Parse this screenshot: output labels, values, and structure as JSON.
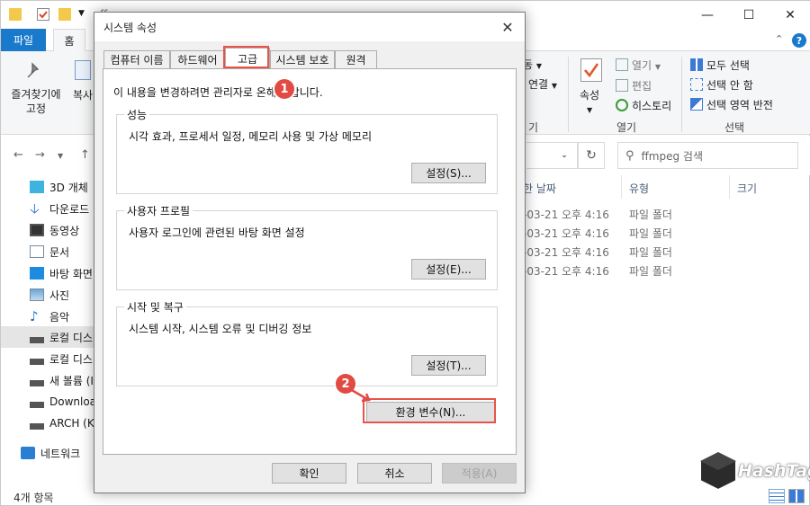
{
  "explorer": {
    "window_title": "ffmpeg",
    "tabs": {
      "file": "파일",
      "home": "홈"
    },
    "ribbon": {
      "pin": "즐겨찾기에\n고정",
      "copy": "복사",
      "clip_a": "동",
      "clip_b": "연결",
      "clip_group": "기",
      "properties": "속성",
      "open": "열기",
      "edit": "편집",
      "history": "히스토리",
      "open_group": "열기",
      "select_all": "모두 선택",
      "select_none": "선택 안 함",
      "invert": "선택 영역 반전",
      "select_group": "선택"
    },
    "search_placeholder": "ffmpeg 검색",
    "nav_items": [
      "3D 개체",
      "다운로드",
      "동영상",
      "문서",
      "바탕 화면",
      "사진",
      "음악",
      "로컬 디스",
      "로컬 디스",
      "새 볼륨 (I",
      "Download",
      "ARCH (K:",
      "네트워크"
    ],
    "columns": {
      "date": "한 날짜",
      "type": "유형",
      "size": "크기"
    },
    "rows": [
      {
        "date": "-03-21 오후 4:16",
        "type": "파일 폴더"
      },
      {
        "date": "-03-21 오후 4:16",
        "type": "파일 폴더"
      },
      {
        "date": "-03-21 오후 4:16",
        "type": "파일 폴더"
      },
      {
        "date": "-03-21 오후 4:16",
        "type": "파일 폴더"
      }
    ],
    "status": "4개 항목"
  },
  "dialog": {
    "title": "시스템 속성",
    "tabs": [
      "컴퓨터 이름",
      "하드웨어",
      "고급",
      "시스템 보호",
      "원격"
    ],
    "active_tab": "고급",
    "note": "이 내용을 변경하려면 관리자로    온해야 합니다.",
    "groups": [
      {
        "title": "성능",
        "desc": "시각 효과, 프로세서 일정, 메모리 사용 및 가상 메모리",
        "button": "설정(S)..."
      },
      {
        "title": "사용자 프로필",
        "desc": "사용자 로그인에 관련된 바탕 화면 설정",
        "button": "설정(E)..."
      },
      {
        "title": "시작 및 복구",
        "desc": "시스템 시작, 시스템 오류 및 디버깅 정보",
        "button": "설정(T)..."
      }
    ],
    "env_button": "환경 변수(N)...",
    "ok": "확인",
    "cancel": "취소",
    "apply": "적용(A)"
  },
  "annotations": {
    "step1": "1",
    "step2": "2"
  },
  "watermark": {
    "text": "HashTag"
  },
  "colors": {
    "accent": "#1979ca",
    "highlight": "#e8534b"
  }
}
